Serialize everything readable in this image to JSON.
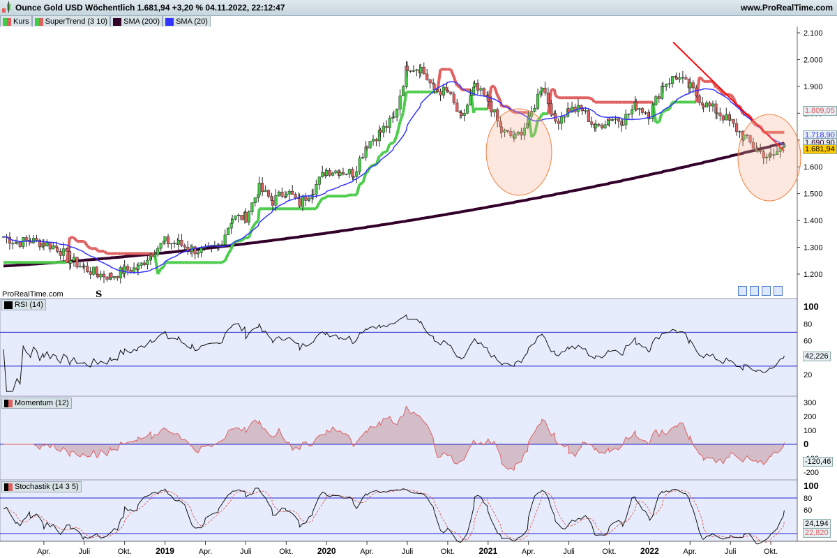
{
  "header": {
    "title": "Ounce Gold USD Wöchentlich 1.681,94 +3,20 % 04.11.2022, 22:12:47",
    "site": "www.ProRealTime.com"
  },
  "legend": [
    {
      "label": "Kurs",
      "color": "#e06060"
    },
    {
      "label": "SuperTrend (3 10)",
      "color": "#4dcc4d"
    },
    {
      "label": "SMA (200)",
      "color": "#33002a"
    },
    {
      "label": "SMA (20)",
      "color": "#3333ff"
    }
  ],
  "watermark": "ProRealTime.com",
  "marker": "S",
  "labels": {
    "supertrend": "1.809,05",
    "sma20": "1.718,90",
    "sma200": "1.690,90",
    "price": "1.681,94",
    "rsi": "42,226",
    "momentum": "-120,46",
    "stoch_k": "24,194",
    "stoch_d": "22,820"
  },
  "panels": {
    "rsi": "RSI (14)",
    "momentum": "Momentum (12)",
    "stoch": "Stochastik (14 3 5)"
  },
  "chart_data": {
    "type": "candlestick",
    "price_axis": {
      "ticks": [
        "2.100",
        "2.000",
        "1.900",
        "1.800",
        "1.700",
        "1.600",
        "1.500",
        "1.400",
        "1.300",
        "1.200"
      ],
      "values": [
        2100,
        2000,
        1900,
        1800,
        1700,
        1600,
        1500,
        1400,
        1300,
        1200
      ]
    },
    "rsi_axis": {
      "ticks": [
        "100",
        "80",
        "60",
        "40",
        "20"
      ],
      "values": [
        100,
        80,
        60,
        40,
        20
      ],
      "levels": [
        70,
        30
      ]
    },
    "momentum_axis": {
      "ticks": [
        "300",
        "200",
        "100",
        "0",
        "-100",
        "-200"
      ],
      "values": [
        300,
        200,
        100,
        0,
        -100,
        -200
      ]
    },
    "stoch_axis": {
      "ticks": [
        "100",
        "80",
        "60",
        "40",
        "20"
      ],
      "values": [
        100,
        80,
        60,
        40,
        20
      ],
      "levels": [
        80,
        20
      ]
    },
    "x_ticks": [
      "Apr.",
      "Juli",
      "Okt.",
      "2019",
      "Apr.",
      "Juli",
      "Okt.",
      "2020",
      "Apr.",
      "Juli",
      "Okt.",
      "2021",
      "Apr.",
      "Juli",
      "Okt.",
      "2022",
      "Apr.",
      "Juli",
      "Okt."
    ],
    "x_tick_months": [
      3,
      6,
      9,
      12,
      15,
      18,
      21,
      24,
      27,
      30,
      33,
      36,
      39,
      42,
      45,
      48,
      51,
      54,
      57
    ],
    "monthly_close": [
      1340,
      1318,
      1325,
      1315,
      1298,
      1252,
      1223,
      1200,
      1192,
      1214,
      1222,
      1281,
      1321,
      1313,
      1292,
      1284,
      1305,
      1409,
      1413,
      1520,
      1472,
      1512,
      1463,
      1517,
      1587,
      1585,
      1577,
      1686,
      1730,
      1780,
      1975,
      1968,
      1886,
      1879,
      1776,
      1895,
      1847,
      1734,
      1707,
      1769,
      1906,
      1770,
      1814,
      1813,
      1743,
      1783,
      1774,
      1829,
      1796,
      1908,
      1937,
      1896,
      1837,
      1807,
      1766,
      1711,
      1660,
      1633,
      1682
    ],
    "sma200_range": [
      1230,
      1690
    ]
  }
}
